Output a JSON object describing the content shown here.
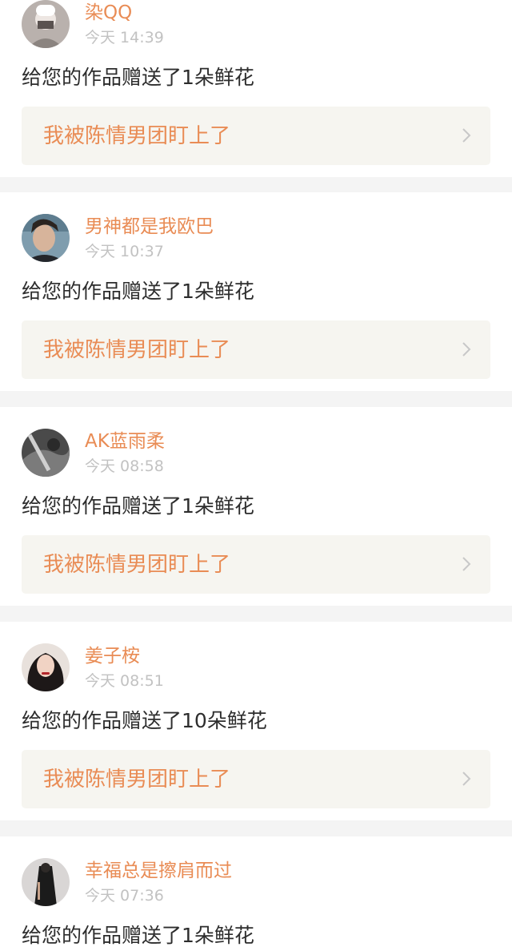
{
  "notifications": [
    {
      "username": "染QQ",
      "time": "今天 14:39",
      "message": "给您的作品赠送了1朵鲜花",
      "work_title": "我被陈情男团盯上了",
      "avatar_icon": "user-avatar-icon"
    },
    {
      "username": "男神都是我欧巴",
      "time": "今天 10:37",
      "message": "给您的作品赠送了1朵鲜花",
      "work_title": "我被陈情男团盯上了",
      "avatar_icon": "user-avatar-icon"
    },
    {
      "username": "AK蓝雨柔",
      "time": "今天 08:58",
      "message": "给您的作品赠送了1朵鲜花",
      "work_title": "我被陈情男团盯上了",
      "avatar_icon": "user-avatar-icon"
    },
    {
      "username": "姜子桉",
      "time": "今天 08:51",
      "message": "给您的作品赠送了10朵鲜花",
      "work_title": "我被陈情男团盯上了",
      "avatar_icon": "user-avatar-icon"
    },
    {
      "username": "幸福总是擦肩而过",
      "time": "今天 07:36",
      "message": "给您的作品赠送了1朵鲜花",
      "work_title": "",
      "avatar_icon": "user-avatar-icon"
    }
  ],
  "colors": {
    "accent": "#e98c55",
    "text": "#2d2d2d",
    "muted": "#c2c2c2",
    "card_bg": "#ffffff",
    "page_bg": "#f4f4f4",
    "link_bg": "#f6f5f0"
  }
}
